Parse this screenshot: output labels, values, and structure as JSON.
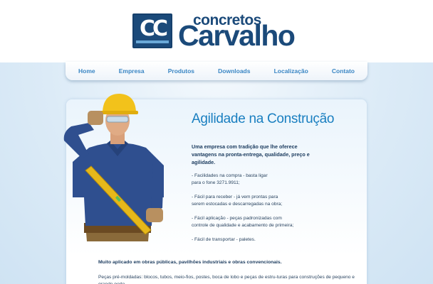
{
  "brand": {
    "logo_mark": "CC",
    "name_top": "concretos",
    "name_main": "Carvalho",
    "color_primary": "#1b4a7a",
    "color_accent": "#1a7fc0"
  },
  "nav": {
    "items": [
      {
        "label": "Home"
      },
      {
        "label": "Empresa"
      },
      {
        "label": "Produtos"
      },
      {
        "label": "Downloads"
      },
      {
        "label": "Localização"
      },
      {
        "label": "Contato"
      }
    ]
  },
  "hero": {
    "title": "Agilidade na Construção",
    "intro": "Uma empresa com tradição que lhe oferece vantagens na pronta-entrega, qualidade, preço e agilidade.",
    "bullets": [
      "- Facilidades na compra - basta ligar\npara o fone 3271.9911;",
      "- Fácil para receber - já vem prontas para\nserem estocadas e descarregadas na obra;",
      "- Fácil aplicação - peças padronizadas com\ncontrole de qualidade e acabamento de primeira;",
      "- Fácil de transportar - paletes."
    ]
  },
  "lower": {
    "bold_line": "Muito aplicado em obras públicas, pavilhões industriais e obras convencionais.",
    "text": "Peças pré-moldadas: blocos, tubos, meio-fios, postes, boca de lobo e peças de estru-turas para construções de pequeno e grande porte."
  },
  "illustration": {
    "subject": "construction-worker-with-level",
    "helmet_color": "#f2c21b",
    "shirt_color": "#2f4f8f",
    "level_color": "#e6b81a"
  }
}
